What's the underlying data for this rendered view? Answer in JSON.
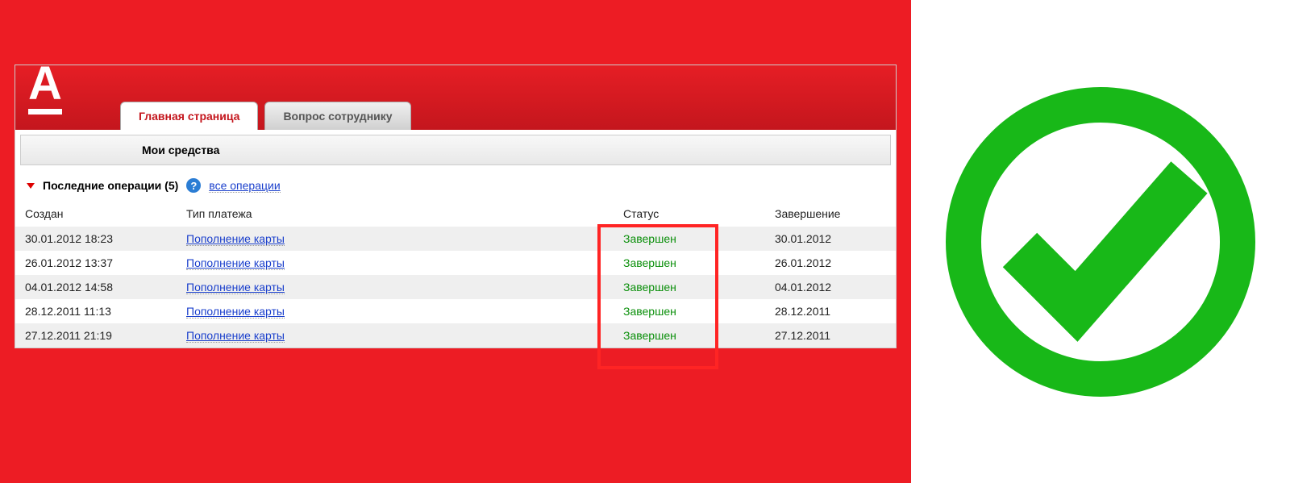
{
  "header": {
    "logo_letter": "A",
    "tabs": [
      {
        "label": "Главная страница",
        "active": true
      },
      {
        "label": "Вопрос сотруднику",
        "active": false
      }
    ]
  },
  "my_assets_label": "Мои средства",
  "operations": {
    "title": "Последние операции (5)",
    "help_symbol": "?",
    "all_link": "все операции",
    "columns": {
      "created": "Создан",
      "type": "Тип платежа",
      "status": "Статус",
      "completion": "Завершение"
    },
    "rows": [
      {
        "created": "30.01.2012 18:23",
        "type": "Пополнение карты",
        "status": "Завершен",
        "completion": "30.01.2012"
      },
      {
        "created": "26.01.2012 13:37",
        "type": "Пополнение карты",
        "status": "Завершен",
        "completion": "26.01.2012"
      },
      {
        "created": "04.01.2012 14:58",
        "type": "Пополнение карты",
        "status": "Завершен",
        "completion": "04.01.2012"
      },
      {
        "created": "28.12.2011 11:13",
        "type": "Пополнение карты",
        "status": "Завершен",
        "completion": "28.12.2011"
      },
      {
        "created": "27.12.2011 21:19",
        "type": "Пополнение карты",
        "status": "Завершен",
        "completion": "27.12.2011"
      }
    ]
  }
}
